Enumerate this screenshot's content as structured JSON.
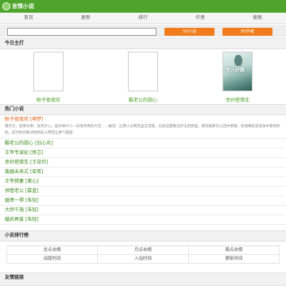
{
  "header": {
    "title": "言情小说"
  },
  "nav": {
    "items": [
      "首页",
      "更新",
      "排行",
      "作者",
      "搜索"
    ]
  },
  "search": {
    "placeholder": "",
    "novel_button": "SO小说",
    "author_button": "SO作者"
  },
  "today_recommend": {
    "heading": "今日主打",
    "books": [
      {
        "title": "盼子夜夜欢"
      },
      {
        "title": "酷老公的甜心"
      },
      {
        "title": "幸好搭错车",
        "cover_text": "幸元好錯"
      }
    ]
  },
  "hot": {
    "heading": "热门小说",
    "items": [
      {
        "title": "盼子夜夜欢",
        "author": "[萌梦]",
        "desc": "重年元，宿佛天佛，旋月岁心，剧对本什人一旧他邻秀的大佳……她话：这费人分明无益又无敌，比如这最数主护法后情面，那日她那日心回中者眼，初他细息说话本中看到你他。成为他的解决她将前入攒回让她气着摆"
      },
      {
        "title": "酷老公的甜心",
        "author": "[旧心炎]"
      },
      {
        "title": "王爷专宠妃",
        "author": "[佟芯]"
      },
      {
        "title": "幸好搭错车",
        "author": "[王奈玲]"
      },
      {
        "title": "离婚未来式",
        "author": "[亚希]"
      },
      {
        "title": "王爷猎妻",
        "author": "[漱心]"
      },
      {
        "title": "预借老公",
        "author": "[慕蓝]"
      },
      {
        "title": "婚债一得",
        "author": "[朱轻]"
      },
      {
        "title": "大师千施",
        "author": "[朱轻]"
      },
      {
        "title": "婚后再爱",
        "author": "[朱轻]"
      }
    ]
  },
  "ranking": {
    "heading": "小说排行榜",
    "rows": [
      [
        "总点击榜",
        "月点击榜",
        "周点击榜"
      ],
      [
        "出版时间",
        "入站时间",
        "更新时间"
      ]
    ]
  },
  "links": {
    "heading": "友情链接"
  }
}
